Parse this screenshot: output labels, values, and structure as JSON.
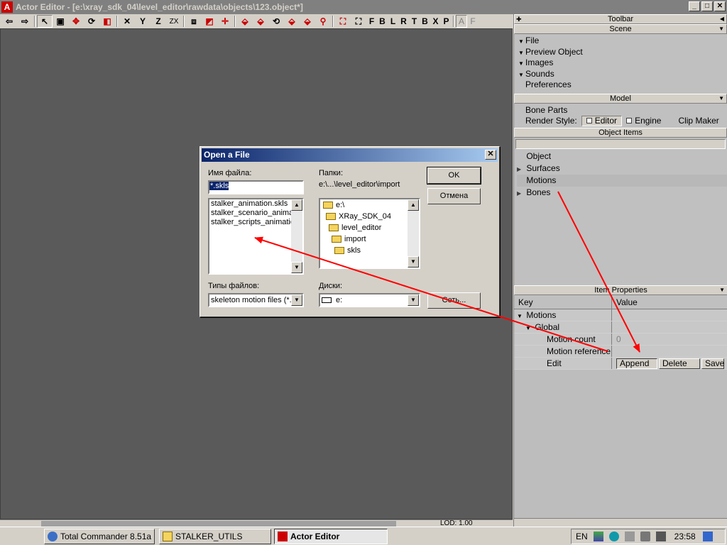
{
  "window": {
    "title": "Actor Editor - [e:\\xray_sdk_04\\level_editor\\rawdata\\objects\\123.object*]",
    "min": "_",
    "max": "□",
    "close": "✕"
  },
  "toolbar": {
    "letters": [
      "X",
      "Y",
      "Z",
      "ZX"
    ],
    "axes": [
      "F",
      "B",
      "L",
      "R",
      "T",
      "B",
      "X",
      "P",
      "A",
      "F"
    ]
  },
  "status": {
    "lod_label": "LOD:",
    "lod_value": "1.00"
  },
  "panel": {
    "toolbar_header": "Toolbar",
    "scene_header": "Scene",
    "scene_items": [
      "File",
      "Preview Object",
      "Images",
      "Sounds",
      "Preferences"
    ],
    "model_header": "Model",
    "bone_parts": "Bone Parts",
    "render_style_label": "Render Style:",
    "render_editor": "Editor",
    "render_engine": "Engine",
    "clip_maker": "Clip Maker",
    "object_items_header": "Object Items",
    "object_items": [
      "Object",
      "Surfaces",
      "Motions",
      "Bones"
    ],
    "item_props_header": "Item Properties",
    "col_key": "Key",
    "col_value": "Value",
    "props": {
      "motions": "Motions",
      "global": "Global",
      "motion_count": "Motion count",
      "motion_count_value": "0",
      "motion_reference": "Motion reference",
      "edit": "Edit",
      "append": "Append",
      "delete": "Delete",
      "save": "Save"
    }
  },
  "dialog": {
    "title": "Open a File",
    "filename_label": "Имя файла:",
    "filename_value": "*.skls",
    "files": [
      "stalker_animation.skls",
      "stalker_scenario_animat",
      "stalker_scripts_animatio"
    ],
    "folders_label": "Папки:",
    "folders_path": "e:\\...\\level_editor\\import",
    "folders": [
      "e:\\",
      "XRay_SDK_04",
      "level_editor",
      "import",
      "skls"
    ],
    "filetype_label": "Типы файлов:",
    "filetype_value": "skeleton motion files (*.s",
    "drives_label": "Диски:",
    "drive_value": "e:",
    "ok": "OK",
    "cancel": "Отмена",
    "network": "Сеть..."
  },
  "taskbar": {
    "tasks": [
      "Total Commander 8.51a ...",
      "STALKER_UTILS",
      "Actor Editor"
    ],
    "lang": "EN",
    "clock": "23:58"
  },
  "colors": {
    "viewport": "#5a5a5a",
    "panel": "#c0c0c0",
    "annotation": "#ff0000",
    "dialog_title": "#0a246a"
  }
}
